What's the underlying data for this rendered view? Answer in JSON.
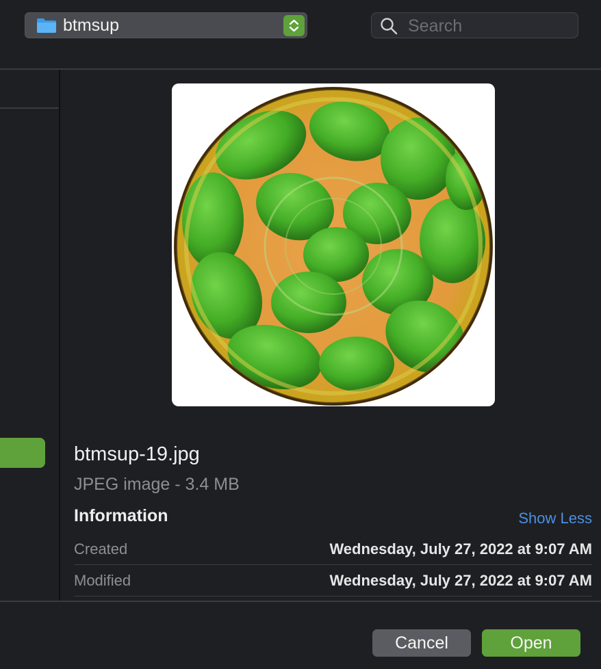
{
  "toolbar": {
    "location": "btmsup",
    "search_placeholder": "Search"
  },
  "preview": {
    "file_name": "btmsup-19.jpg",
    "file_kind": "JPEG image - 3.4 MB"
  },
  "information": {
    "title": "Information",
    "toggle_label": "Show Less",
    "rows": [
      {
        "key": "Created",
        "value": "Wednesday, July 27, 2022 at 9:07 AM"
      },
      {
        "key": "Modified",
        "value": "Wednesday, July 27, 2022 at 9:07 AM"
      }
    ]
  },
  "buttons": {
    "cancel": "Cancel",
    "open": "Open"
  },
  "icons": {
    "folder": "folder-icon",
    "stepper": "up-down-chevron-icon",
    "search": "magnifier-icon"
  },
  "colors": {
    "accent": "#5fa13a",
    "link": "#4a90e2",
    "background": "#1e1f23"
  }
}
